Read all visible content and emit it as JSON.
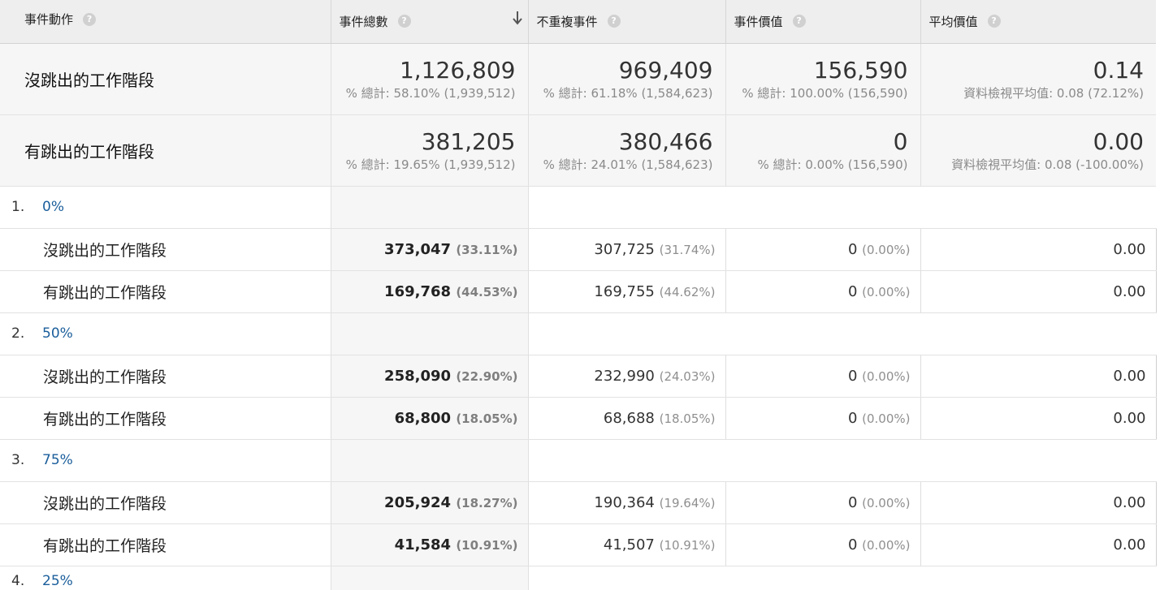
{
  "header": {
    "col_action": "事件動作",
    "col_total": "事件總數",
    "col_unique": "不重複事件",
    "col_value": "事件價值",
    "col_avg": "平均價值",
    "help_glyph": "?"
  },
  "totals": [
    {
      "label": "沒跳出的工作階段",
      "total": "1,126,809",
      "total_sub": "% 總計: 58.10% (1,939,512)",
      "unique": "969,409",
      "unique_sub": "% 總計: 61.18% (1,584,623)",
      "value": "156,590",
      "value_sub": "% 總計: 100.00% (156,590)",
      "avg": "0.14",
      "avg_sub": "資料檢視平均值: 0.08 (72.12%)"
    },
    {
      "label": "有跳出的工作階段",
      "total": "381,205",
      "total_sub": "% 總計: 19.65% (1,939,512)",
      "unique": "380,466",
      "unique_sub": "% 總計: 24.01% (1,584,623)",
      "value": "0",
      "value_sub": "% 總計: 0.00% (156,590)",
      "avg": "0.00",
      "avg_sub": "資料檢視平均值: 0.08 (-100.00%)"
    }
  ],
  "groups": [
    {
      "num": "1.",
      "label": "0%",
      "rows": [
        {
          "label": "沒跳出的工作階段",
          "total": "373,047",
          "total_pct": "(33.11%)",
          "unique": "307,725",
          "unique_pct": "(31.74%)",
          "value": "0",
          "value_pct": "(0.00%)",
          "avg": "0.00"
        },
        {
          "label": "有跳出的工作階段",
          "total": "169,768",
          "total_pct": "(44.53%)",
          "unique": "169,755",
          "unique_pct": "(44.62%)",
          "value": "0",
          "value_pct": "(0.00%)",
          "avg": "0.00"
        }
      ]
    },
    {
      "num": "2.",
      "label": "50%",
      "rows": [
        {
          "label": "沒跳出的工作階段",
          "total": "258,090",
          "total_pct": "(22.90%)",
          "unique": "232,990",
          "unique_pct": "(24.03%)",
          "value": "0",
          "value_pct": "(0.00%)",
          "avg": "0.00"
        },
        {
          "label": "有跳出的工作階段",
          "total": "68,800",
          "total_pct": "(18.05%)",
          "unique": "68,688",
          "unique_pct": "(18.05%)",
          "value": "0",
          "value_pct": "(0.00%)",
          "avg": "0.00"
        }
      ]
    },
    {
      "num": "3.",
      "label": "75%",
      "rows": [
        {
          "label": "沒跳出的工作階段",
          "total": "205,924",
          "total_pct": "(18.27%)",
          "unique": "190,364",
          "unique_pct": "(19.64%)",
          "value": "0",
          "value_pct": "(0.00%)",
          "avg": "0.00"
        },
        {
          "label": "有跳出的工作階段",
          "total": "41,584",
          "total_pct": "(10.91%)",
          "unique": "41,507",
          "unique_pct": "(10.91%)",
          "value": "0",
          "value_pct": "(0.00%)",
          "avg": "0.00"
        }
      ]
    }
  ],
  "partial_group": {
    "num": "4.",
    "label": "25%"
  },
  "colors": {
    "link": "#1a5e9b",
    "header_bg": "#eeeeee",
    "highlight_bg": "#f6f6f6",
    "muted": "#8a8a8a"
  },
  "icons": {
    "help": "help-icon",
    "sort": "sort-descending-arrow-icon"
  }
}
